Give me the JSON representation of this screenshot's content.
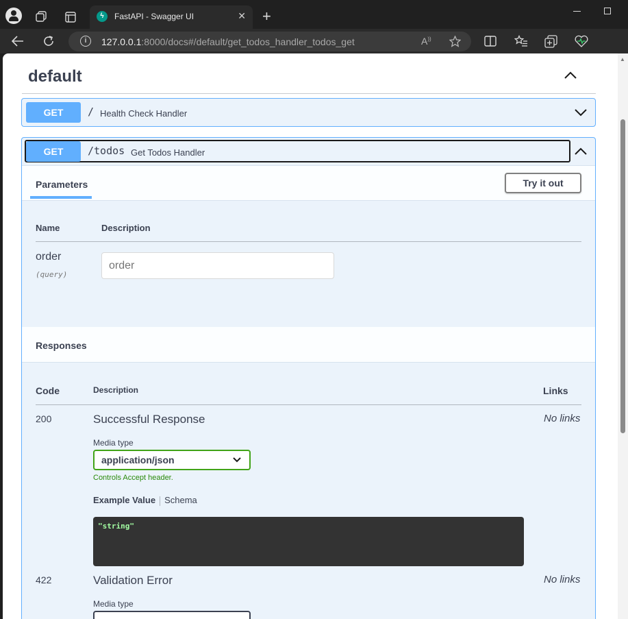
{
  "browser": {
    "tab_title": "FastAPI - Swagger UI",
    "tab_close": "✕",
    "new_tab": "+",
    "url_host": "127.0.0.1",
    "url_rest": ":8000/docs#/default/get_todos_handler_todos_get"
  },
  "swagger": {
    "tag": "default",
    "ops": [
      {
        "method": "GET",
        "path": "/",
        "summary": "Health Check Handler"
      },
      {
        "method": "GET",
        "path": "/todos",
        "summary": "Get Todos Handler"
      }
    ],
    "params": {
      "title": "Parameters",
      "try_label": "Try it out",
      "col_name": "Name",
      "col_desc": "Description",
      "param_name": "order",
      "param_in": "(query)",
      "param_placeholder": "order"
    },
    "responses": {
      "title": "Responses",
      "col_code": "Code",
      "col_desc": "Description",
      "col_links": "Links",
      "media_type_label": "Media type",
      "media_type_value": "application/json",
      "controls_note": "Controls Accept header.",
      "example_tab": "Example Value",
      "schema_tab": "Schema",
      "example_body": "\"string\"",
      "items": [
        {
          "code": "200",
          "desc": "Successful Response",
          "links": "No links"
        },
        {
          "code": "422",
          "desc": "Validation Error",
          "links": "No links"
        }
      ]
    }
  },
  "colors": {
    "get": "#61affe",
    "select_border": "#41a317"
  }
}
